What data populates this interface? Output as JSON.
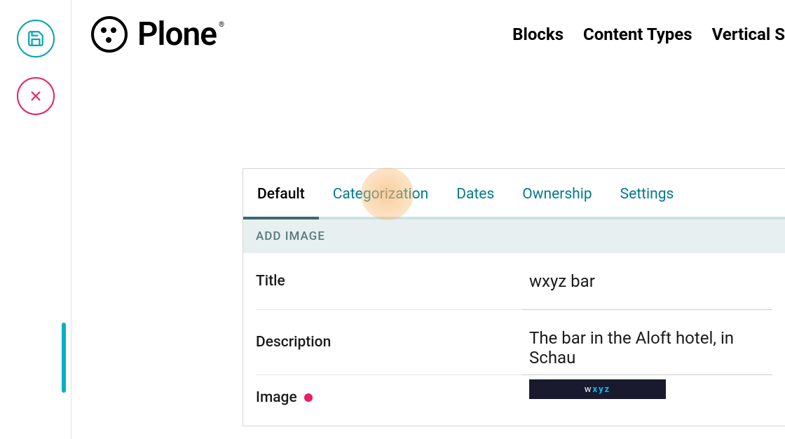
{
  "logo": {
    "text": "Plone",
    "reg": "®"
  },
  "nav": {
    "blocks": "Blocks",
    "contentTypes": "Content Types",
    "verticalS": "Vertical S"
  },
  "tabs": {
    "default": "Default",
    "categorization": "Categorization",
    "dates": "Dates",
    "ownership": "Ownership",
    "settings": "Settings"
  },
  "section": {
    "addImage": "ADD IMAGE"
  },
  "fields": {
    "titleLabel": "Title",
    "titleValue": "wxyz bar",
    "descriptionLabel": "Description",
    "descriptionValue": "The bar in the Aloft hotel, in Schau",
    "imageLabel": "Image",
    "thumbW": "w",
    "thumbXyz": "xyz"
  }
}
